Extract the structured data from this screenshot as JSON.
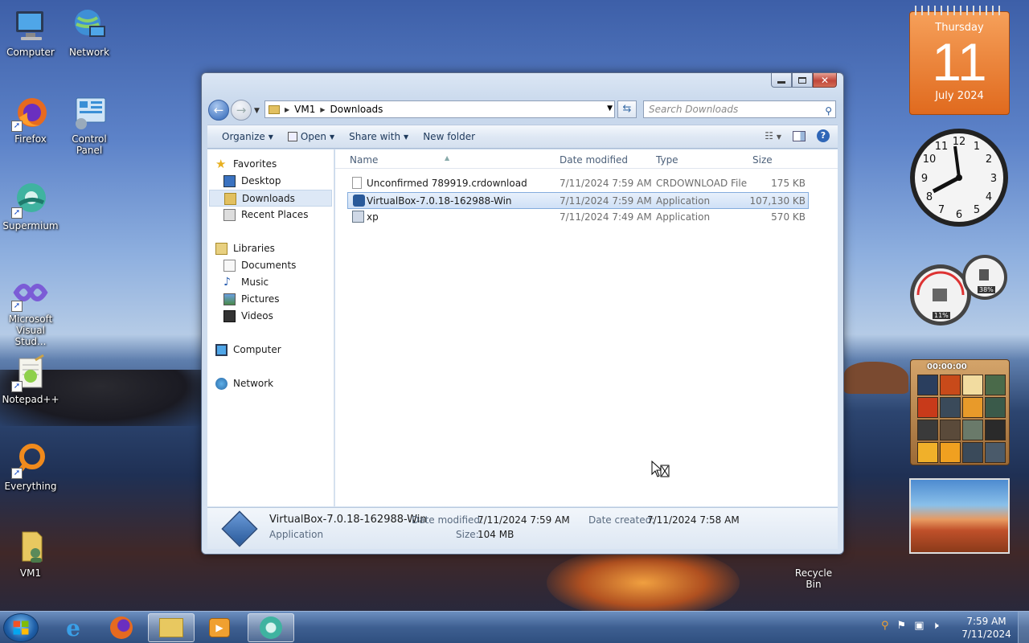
{
  "desktop": {
    "icons": [
      {
        "label": "Computer"
      },
      {
        "label": "Network"
      },
      {
        "label": "Firefox"
      },
      {
        "label": "Control Panel"
      },
      {
        "label": "Supermium"
      },
      {
        "label": "Microsoft Visual Stud..."
      },
      {
        "label": "Notepad++"
      },
      {
        "label": "Everything"
      },
      {
        "label": "VM1"
      },
      {
        "label": "Recycle Bin"
      }
    ]
  },
  "gadgets": {
    "calendar": {
      "weekday": "Thursday",
      "day": "11",
      "month_year": "July 2024"
    },
    "cpu_meter": {
      "cpu": "11%",
      "memory": "38%"
    },
    "puzzle": {
      "timer": "00:00:00"
    }
  },
  "explorer": {
    "breadcrumb": [
      "VM1",
      "Downloads"
    ],
    "search_placeholder": "Search Downloads",
    "toolbar": {
      "organize": "Organize",
      "open": "Open",
      "share_with": "Share with",
      "new_folder": "New folder"
    },
    "nav": {
      "favorites": "Favorites",
      "desktop": "Desktop",
      "downloads": "Downloads",
      "recent_places": "Recent Places",
      "libraries": "Libraries",
      "documents": "Documents",
      "music": "Music",
      "pictures": "Pictures",
      "videos": "Videos",
      "computer": "Computer",
      "network": "Network"
    },
    "columns": {
      "name": "Name",
      "date_modified": "Date modified",
      "type": "Type",
      "size": "Size"
    },
    "files": [
      {
        "name": "Unconfirmed 789919.crdownload",
        "date": "7/11/2024 7:59 AM",
        "type": "CRDOWNLOAD File",
        "size": "175 KB"
      },
      {
        "name": "VirtualBox-7.0.18-162988-Win",
        "date": "7/11/2024 7:59 AM",
        "type": "Application",
        "size": "107,130 KB"
      },
      {
        "name": "xp",
        "date": "7/11/2024 7:49 AM",
        "type": "Application",
        "size": "570 KB"
      }
    ],
    "details": {
      "name": "VirtualBox-7.0.18-162988-Win",
      "type": "Application",
      "date_modified_label": "Date modified:",
      "date_modified": "7/11/2024 7:59 AM",
      "date_created_label": "Date created:",
      "date_created": "7/11/2024 7:58 AM",
      "size_label": "Size:",
      "size": "104 MB"
    }
  },
  "taskbar": {
    "time": "7:59 AM",
    "date": "7/11/2024"
  }
}
